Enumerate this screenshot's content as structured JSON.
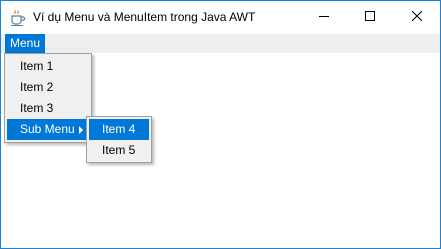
{
  "window": {
    "title": "Ví dụ Menu và MenuItem trong Java AWT",
    "app_icon": "java-cup-icon",
    "controls": [
      "minimize-icon",
      "maximize-icon",
      "close-icon"
    ]
  },
  "menubar": {
    "menus": [
      {
        "label": "Menu",
        "active": true
      }
    ]
  },
  "menu_popup": {
    "items": [
      {
        "label": "Item 1"
      },
      {
        "label": "Item 2"
      },
      {
        "label": "Item 3"
      },
      {
        "label": "Sub Menu",
        "has_submenu": true,
        "highlighted": true
      }
    ]
  },
  "submenu_popup": {
    "items": [
      {
        "label": "Item 4",
        "highlighted": true
      },
      {
        "label": "Item 5"
      }
    ]
  },
  "colors": {
    "accent": "#0078d7",
    "window_border": "#1883d7",
    "menubar_bg": "#eeeeee",
    "popup_bg": "#f0f0f0"
  }
}
